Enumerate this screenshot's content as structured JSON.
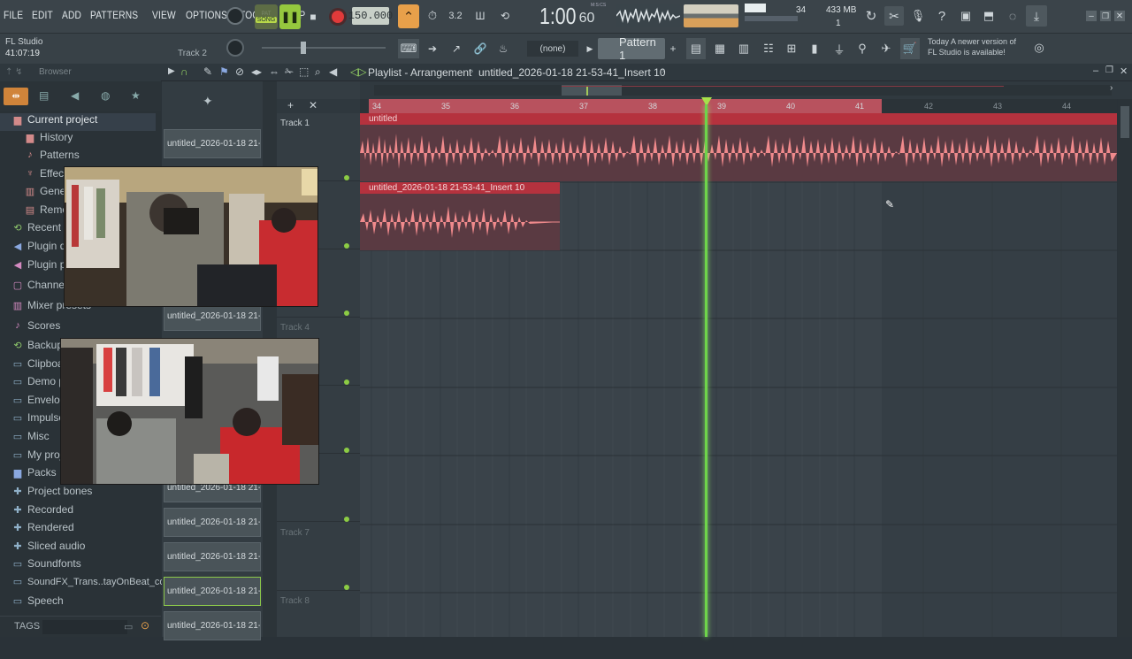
{
  "menu": [
    "FILE",
    "EDIT",
    "ADD",
    "PATTERNS",
    "VIEW",
    "OPTIONS",
    "TOOLS",
    "HELP"
  ],
  "transport": {
    "mode": "SONG",
    "tempo": "150.000",
    "time": "1:00",
    "time_small": "60",
    "time_unit": "M:S:CS",
    "cpu": "34",
    "mem": "433 MB",
    "poly": "1"
  },
  "app": {
    "name": "FL Studio",
    "clock": "41:07:19",
    "track_hint": "Track 2"
  },
  "pattern": {
    "none": "(none)",
    "name": "Pattern 1"
  },
  "notice": {
    "line1": "Today  A newer version of",
    "line2": "FL Studio is available!"
  },
  "browser": {
    "title": "Browser",
    "tags": "TAGS",
    "items": [
      "Current project",
      "History",
      "Patterns",
      "Effects",
      "Generators",
      "Remote",
      "Recent",
      "Plugin database",
      "Plugin presets",
      "Channel presets",
      "Mixer presets",
      "Scores",
      "Backup",
      "Clipboard",
      "Demo projects",
      "Envelopes",
      "Impulses",
      "Misc",
      "My projects",
      "Packs",
      "Project bones",
      "Recorded",
      "Rendered",
      "Sliced audio",
      "Soundfonts",
      "SoundFX_Trans..tayOnBeat_com",
      "Speech"
    ]
  },
  "playlist": {
    "title": "Playlist - Arrangement",
    "crumb": "untitled_2026-01-18 21-53-41_Insert 10"
  },
  "clips_list": [
    "untitled_2026-01-18 21-..."
  ],
  "tracks": [
    "Track 1",
    "Track 4",
    "Track 7",
    "Track 8"
  ],
  "ruler": [
    "34",
    "35",
    "36",
    "37",
    "38",
    "39",
    "40",
    "41",
    "42",
    "43",
    "44"
  ],
  "clip1": {
    "label": "untitled"
  },
  "clip2": {
    "label": "untitled_2026-01-18 21-53-41_Insert 10"
  }
}
